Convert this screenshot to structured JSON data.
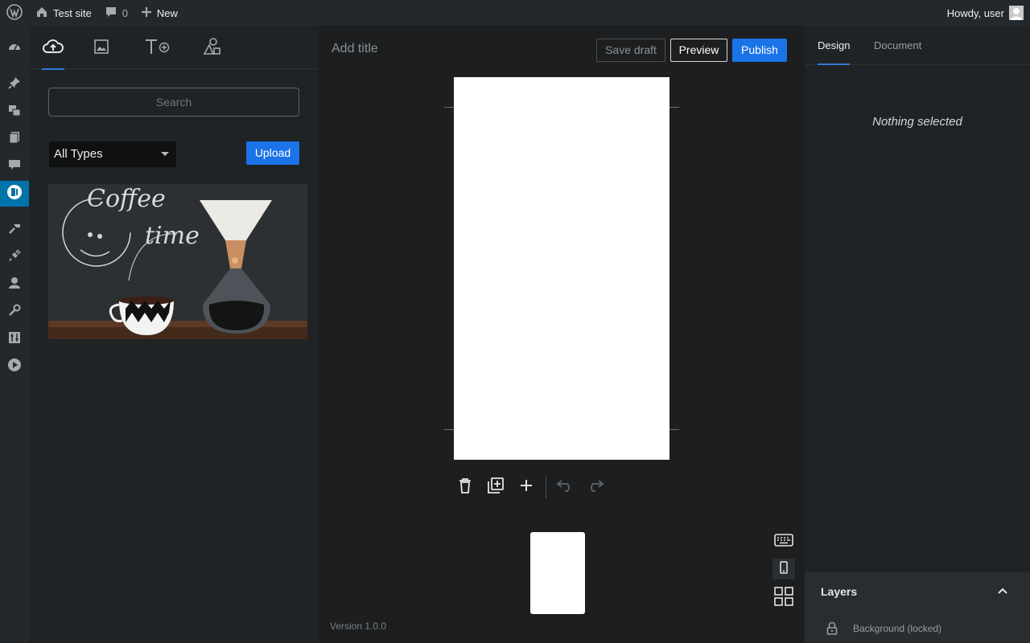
{
  "admin_bar": {
    "site_name": "Test site",
    "comments_count": "0",
    "new_label": "New",
    "greeting": "Howdy, user"
  },
  "wp_menu": {
    "icons": [
      "dashboard-icon",
      "pin-icon",
      "media-icon",
      "pages-icon",
      "comments-icon",
      "stories-icon",
      "appearance-icon",
      "plugins-icon",
      "users-icon",
      "tools-icon",
      "settings-icon",
      "play-icon"
    ]
  },
  "library": {
    "tabs": [
      "upload-icon",
      "image-icon",
      "text-icon",
      "shapes-icon"
    ],
    "search_placeholder": "Search",
    "type_filter": "All Types",
    "upload_label": "Upload",
    "media_items": [
      {
        "text": "Coffee time",
        "kind": "image"
      }
    ]
  },
  "editor": {
    "title_placeholder": "Add title",
    "save_draft_label": "Save draft",
    "preview_label": "Preview",
    "publish_label": "Publish",
    "version": "Version 1.0.0"
  },
  "inspector": {
    "tabs": [
      "Design",
      "Document"
    ],
    "empty_message": "Nothing selected",
    "layers_title": "Layers",
    "layers": [
      "Background (locked)"
    ]
  },
  "colors": {
    "accent": "#1b73e8",
    "active_menu": "#0073aa"
  }
}
